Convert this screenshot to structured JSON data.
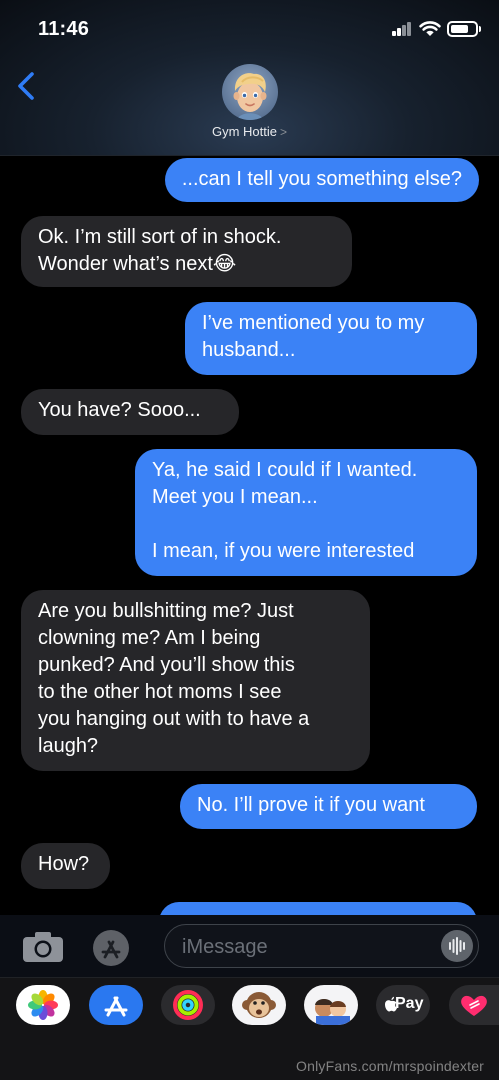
{
  "status_bar": {
    "time": "11:46"
  },
  "header": {
    "contact_name": "Gym Hottie",
    "chevron": ">"
  },
  "messages": [
    {
      "side": "sent",
      "text": "...can I tell you something else?"
    },
    {
      "side": "received",
      "text": "Ok.  I’m still sort of in shock.\nWonder what’s next😂"
    },
    {
      "side": "sent",
      "text": "I’ve mentioned you to my\nhusband..."
    },
    {
      "side": "received",
      "text": "You have?  Sooo..."
    },
    {
      "side": "sent",
      "text": "Ya, he said I could if I wanted.\nMeet you I mean...\n\nI mean, if you were interested"
    },
    {
      "side": "received",
      "text": "Are you bullshitting me?  Just\nclowning me?  Am I being\npunked?  And you’ll show this\nto the other hot moms I see\nyou hanging out with to have a\nlaugh?"
    },
    {
      "side": "sent",
      "text": "No.  I’ll prove it if you want"
    },
    {
      "side": "received",
      "text": "How?"
    }
  ],
  "compose": {
    "placeholder": "iMessage"
  },
  "app_drawer": {
    "apps": [
      "photos-icon",
      "app-store-icon",
      "activity-icon",
      "monkey-memoji-icon",
      "memoji-stickers-icon",
      "apple-pay-icon",
      "digital-touch-icon"
    ],
    "apple_pay_label": "Pay"
  },
  "watermark": "OnlyFans.com/mrspoindexter",
  "colors": {
    "sent_bubble": "#3b82f6",
    "received_bubble": "#262629",
    "background": "#000000",
    "accent": "#2f7cf6"
  }
}
